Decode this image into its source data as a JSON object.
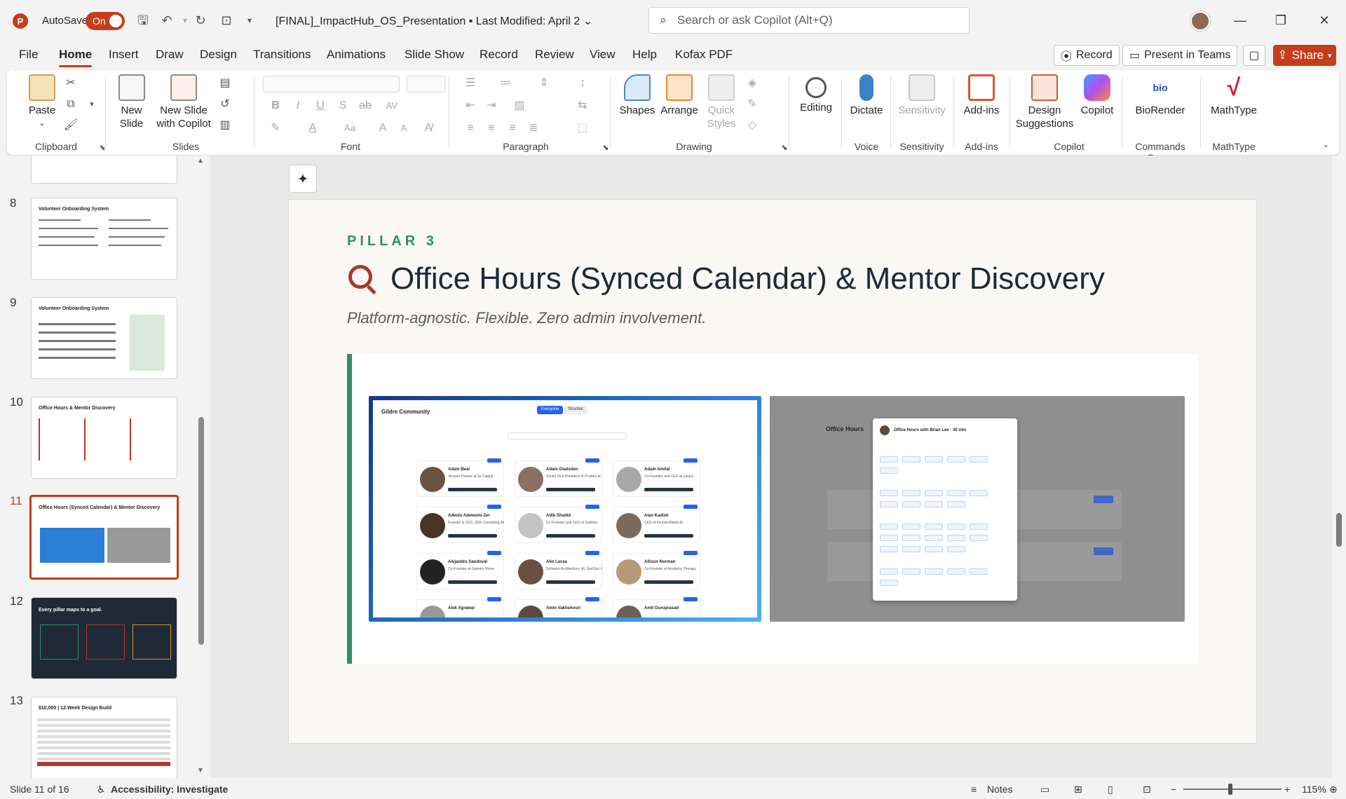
{
  "titlebar": {
    "app_letter": "P",
    "autosave_label": "AutoSave",
    "autosave_state": "On",
    "doc_title": "[FINAL]_ImpactHub_OS_Presentation • Last Modified: April 2",
    "search_placeholder": "Search or ask Copilot (Alt+Q)"
  },
  "tabs": [
    "File",
    "Home",
    "Insert",
    "Draw",
    "Design",
    "Transitions",
    "Animations",
    "Slide Show",
    "Record",
    "Review",
    "View",
    "Help",
    "Kofax PDF"
  ],
  "active_tab": "Home",
  "actions": {
    "record": "Record",
    "present": "Present in Teams",
    "share": "Share"
  },
  "ribbon": {
    "paste": "Paste",
    "new_slide": "New\nSlide",
    "new_slide_copilot": "New Slide\nwith Copilot",
    "shapes": "Shapes",
    "arrange": "Arrange",
    "quick_styles": "Quick\nStyles",
    "editing": "Editing",
    "dictate": "Dictate",
    "sensitivity": "Sensitivity",
    "addins": "Add-ins",
    "design_suggestions": "Design\nSuggestions",
    "copilot": "Copilot",
    "biorender": "BioRender",
    "mathtype": "MathType",
    "groups": {
      "clipboard": "Clipboard",
      "slides": "Slides",
      "font": "Font",
      "paragraph": "Paragraph",
      "drawing": "Drawing",
      "voice": "Voice",
      "sensitivity": "Sensitivity",
      "addins": "Add-ins",
      "copilot": "Copilot",
      "commands": "Commands Group",
      "mathtype": "MathType"
    }
  },
  "thumbnails": [
    {
      "num": "8",
      "title": "Volunteer Onboarding System"
    },
    {
      "num": "9",
      "title": "Volunteer Onboarding System"
    },
    {
      "num": "10",
      "title": "Office Hours & Mentor Discovery"
    },
    {
      "num": "11",
      "title": "Office Hours (Synced Calendar) & Mentor Discovery"
    },
    {
      "num": "12",
      "title": "Every pillar maps to a goal."
    },
    {
      "num": "13",
      "title": "$10,000 | 12-Week Design Build"
    }
  ],
  "slide": {
    "eyebrow": "PILLAR 3",
    "title": "Office Hours (Synced Calendar) & Mentor Discovery",
    "subtitle": "Platform-agnostic. Flexible. Zero admin involvement.",
    "shot_a": {
      "brand": "Gildre Community",
      "seg_everyone": "Everyone",
      "seg_shortlist": "Shortlist",
      "people": [
        {
          "name": "Adam Beal",
          "role": "Venture Partner at 3z Capital"
        },
        {
          "name": "Adam Gladsden",
          "role": "Senior Vice President of Product at ..."
        },
        {
          "name": "Adam Amital",
          "role": "Co-Founder and CEO at Lanea"
        },
        {
          "name": "Adeolu Adewumi-Zer",
          "role": "Founder & CEO, ZER Consulting Africa"
        },
        {
          "name": "Adib Shadid",
          "role": "Co-Founder and CEO of Gathery"
        },
        {
          "name": "Alan Kadish",
          "role": "CEO of InvestorMatch AI"
        },
        {
          "name": "Alejandro Sandoval",
          "role": "Co-Founder at Gamers Home"
        },
        {
          "name": "Alin Lacea",
          "role": "Software Architecture, AI, DevOps, F..."
        },
        {
          "name": "Allison Norman",
          "role": "Co-Founder at Academy Therapy"
        },
        {
          "name": "Alok Agrawal",
          "role": ""
        },
        {
          "name": "Amin Vakhshouri",
          "role": ""
        },
        {
          "name": "Amit Guruprasad",
          "role": ""
        }
      ]
    },
    "shot_b": {
      "title": "Office Hours",
      "modal_title": "Office Hours with Brian Lee · 30 min"
    }
  },
  "status": {
    "slide_of": "Slide 11 of 16",
    "accessibility": "Accessibility: Investigate",
    "notes": "Notes",
    "zoom": "115%"
  }
}
